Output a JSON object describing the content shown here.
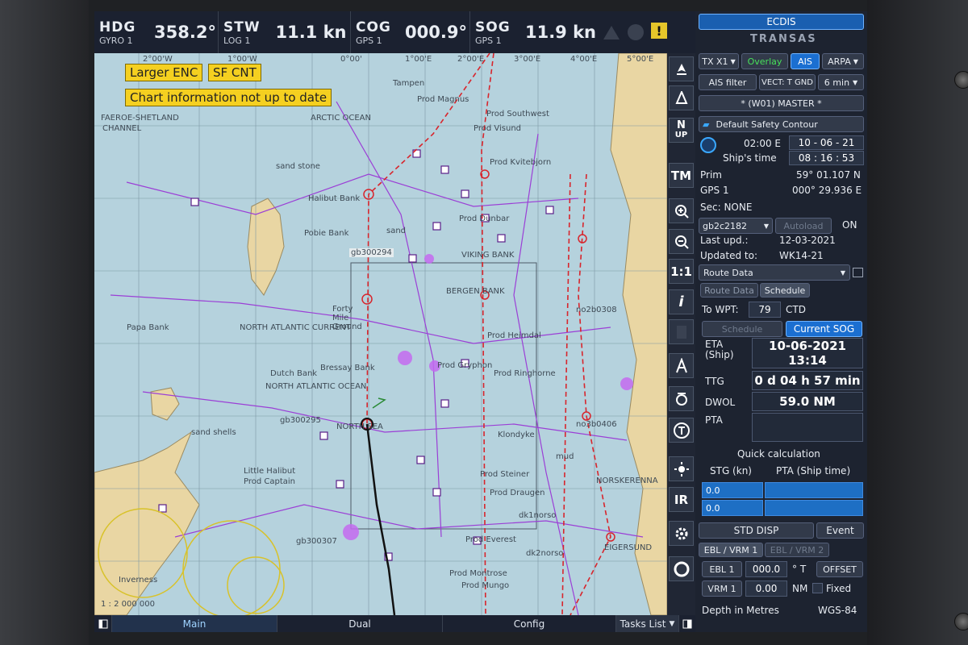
{
  "topbar": {
    "hdg": {
      "label": "HDG",
      "sub": "GYRO 1",
      "value": "358.2°"
    },
    "stw": {
      "label": "STW",
      "sub": "LOG 1",
      "value": "11.1 kn"
    },
    "cog": {
      "label": "COG",
      "sub": "GPS 1",
      "value": "000.9°"
    },
    "sog": {
      "label": "SOG",
      "sub": "GPS 1",
      "value": "11.9 kn"
    },
    "warning_symbol": "!"
  },
  "chart": {
    "badges": {
      "larger_enc": "Larger ENC",
      "sf_cnt": "SF CNT",
      "not_up_to_date": "Chart information not up to date"
    },
    "labels": {
      "tampen": "Tampen",
      "arctic_ocean": "ARCTIC OCEAN",
      "faroe": "FAEROE-SHETLAND",
      "channel": "CHANNEL",
      "prod_magnus": "Prod Magnus",
      "sw": "Prod Southwest",
      "visund": "Prod Visund",
      "kvitebjorn": "Prod Kvitebjorn",
      "sand_stone": "sand stone",
      "halibut": "Halibut Bank",
      "dunbar": "Prod Dunbar",
      "pobie": "Pobie Bank",
      "sand": "sand",
      "viking": "VIKING BANK",
      "gb300294": "gb300294",
      "bergen": "BERGEN BANK",
      "forty_mile": "Forty Mile Ground",
      "north_atlantic": "NORTH ATLANTIC CURRENT",
      "papa": "Papa Bank",
      "no2b0308": "no2b0308",
      "heimdal": "Prod Heimdal",
      "dutch": "Dutch Bank",
      "nao": "NORTH ATLANTIC OCEAN",
      "bressay": "Bressay Bank",
      "gryphon": "Prod Gryphon",
      "ringhorne": "Prod Ringhorne",
      "northsea": "NORTH SEA",
      "gb300295": "gb300295",
      "no3b0406": "no3b0406",
      "klondyke": "Klondyke",
      "mud": "mud",
      "sand_shells": "sand shells",
      "steiner": "Prod Steiner",
      "little_halibut": "Little Halibut",
      "pro_captain": "Prod Captain",
      "draugen": "Prod Draugen",
      "norskerenna": "NORSKERENNA",
      "eigersund": "EIGERSUND",
      "everest": "Prod Everest",
      "dk1norso": "dk1norso",
      "dk2norso": "dk2norso",
      "montrose": "Prod Montrose",
      "mungo": "Prod Mungo",
      "scale": "1 : 2 000 000",
      "inverness": "Inverness",
      "gb300307": "gb300307"
    },
    "ticks": [
      "2°00'W",
      "1°00'W",
      "0°00'",
      "1°00'E",
      "2°00'E",
      "3°00'E",
      "4°00'E",
      "5°00'E"
    ]
  },
  "tools": {
    "north_up": "N",
    "north_up_sub": "UP",
    "tm": "TM",
    "scale11": "1:1",
    "info": "i",
    "ir": "IR"
  },
  "bottombar": {
    "main": "Main",
    "dual": "Dual",
    "config": "Config",
    "tasks": "Tasks List"
  },
  "panel": {
    "ecdis": "ECDIS",
    "brand": "TRANSAS",
    "tx": "TX X1",
    "overlay": "Overlay",
    "ais": "AIS",
    "arpa": "ARPA",
    "ais_filter": "AIS filter",
    "vect": "VECT: T GND",
    "vect_time": "6 min",
    "master": "* (W01) MASTER *",
    "safety": "Default Safety Contour",
    "tz": "02:00 E",
    "ship_time_label": "Ship's time",
    "date": "10 - 06 - 21",
    "time": "08 : 16 : 53",
    "prim_label": "Prim",
    "lat": "59° 01.107 N",
    "gps_label": "GPS 1",
    "lon": "000° 29.936 E",
    "sec": "Sec: NONE",
    "chart_id": "gb2c2182",
    "autoload": "Autoload",
    "on": "ON",
    "last_upd_label": "Last upd.:",
    "last_upd": "12-03-2021",
    "updated_to_label": "Updated to:",
    "updated_to": "WK14-21",
    "route_data": "Route Data",
    "tab_route": "Route Data",
    "tab_schedule": "Schedule",
    "to_wpt_label": "To WPT:",
    "wpt": "79",
    "ctd": "CTD",
    "schedule_btn": "Schedule",
    "current_sog": "Current SOG",
    "eta_label": "ETA",
    "eta_sub": "(Ship)",
    "eta_date": "10-06-2021",
    "eta_time": "13:14",
    "ttg_label": "TTG",
    "ttg": "0 d 04 h 57 min",
    "dwol_label": "DWOL",
    "dwol": "59.0 NM",
    "pta_label": "PTA",
    "quick": "Quick calculation",
    "stg_head": "STG (kn)",
    "pta_head": "PTA (Ship time)",
    "stg1": "0.0",
    "stg2": "0.0",
    "std_disp": "STD DISP",
    "event": "Event",
    "ebl1_tab": "EBL / VRM 1",
    "ebl2_tab": "EBL / VRM 2",
    "ebl1": "EBL 1",
    "ebl1_val": "000.0",
    "ebl_unit": "° T",
    "offset": "OFFSET",
    "vrm1": "VRM 1",
    "vrm1_val": "0.00",
    "vrm_unit": "NM",
    "fixed": "Fixed",
    "depth": "Depth in Metres",
    "datum": "WGS-84"
  }
}
